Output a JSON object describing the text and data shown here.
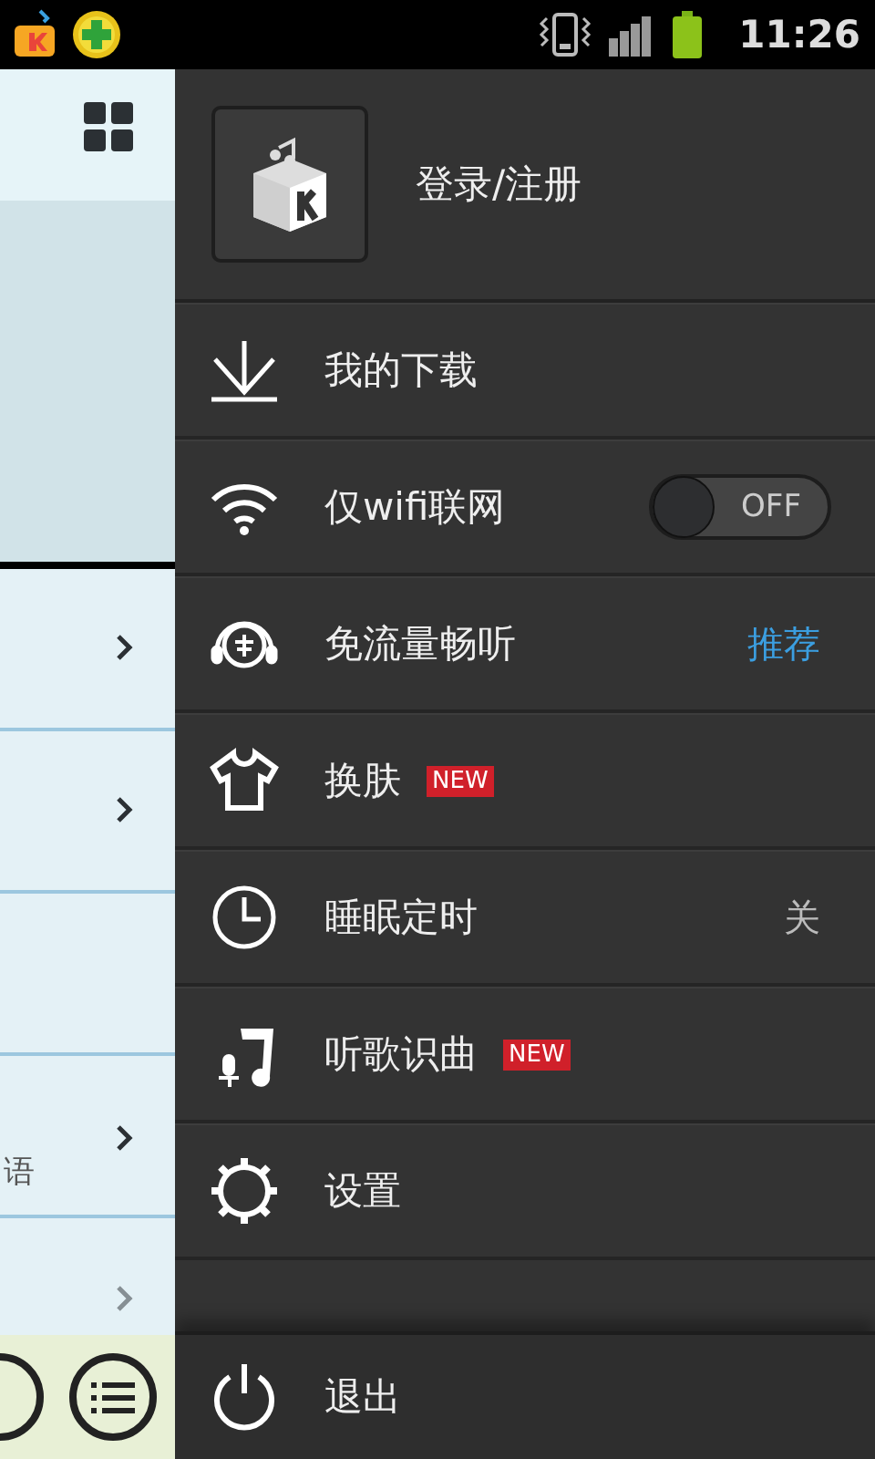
{
  "status_bar": {
    "time": "11:26"
  },
  "background_screen": {
    "rows": [
      {
        "chevron": true
      },
      {
        "chevron": true
      },
      {
        "chevron": false
      },
      {
        "chevron": true,
        "text": "语"
      },
      {
        "chevron": true
      }
    ]
  },
  "drawer": {
    "account": {
      "label": "登录/注册"
    },
    "items": [
      {
        "kind": "link",
        "label": "我的下载"
      },
      {
        "kind": "toggle",
        "label": "仅wifi联网",
        "on": false,
        "state_label": "OFF"
      },
      {
        "kind": "value",
        "label": "免流量畅听",
        "value": "推荐",
        "highlight": true
      },
      {
        "kind": "badge",
        "label": "换肤",
        "badge": "NEW"
      },
      {
        "kind": "value",
        "label": "睡眠定时",
        "value": "关",
        "highlight": false
      },
      {
        "kind": "badge",
        "label": "听歌识曲",
        "badge": "NEW"
      },
      {
        "kind": "link",
        "label": "设置"
      }
    ],
    "footer": {
      "label": "退出"
    }
  }
}
